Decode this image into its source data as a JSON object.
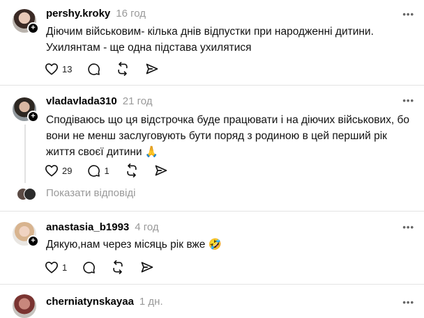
{
  "comments": [
    {
      "username": "pershy.kroky",
      "time": "16 год",
      "text": "Діючим військовим- кілька днів відпустки при народженні дитини. Ухилянтам - ще одна підстава ухилятися",
      "likes": "13",
      "replies": ""
    },
    {
      "username": "vladavlada310",
      "time": "21 год",
      "text": "Сподіваюсь що ця відстрочка буде працювати і на діючих військових, бо вони не менш заслуговують бути поряд з родиною в цей перший рік життя своєї дитини",
      "emoji": "🙏",
      "likes": "29",
      "replies": "1",
      "show_replies": "Показати відповіді"
    },
    {
      "username": "anastasia_b1993",
      "time": "4 год",
      "text": "Дякую,нам через місяць рік вже",
      "emoji": "🤣",
      "likes": "1",
      "replies": ""
    },
    {
      "username": "cherniatynskayaa",
      "time": "1 дн."
    }
  ],
  "icons": {
    "more": "more-dots-icon",
    "like": "heart-icon",
    "reply": "comment-icon",
    "repost": "repost-icon",
    "share": "send-icon",
    "follow": "plus-icon"
  },
  "more_glyph": "•••",
  "plus_glyph": "+"
}
